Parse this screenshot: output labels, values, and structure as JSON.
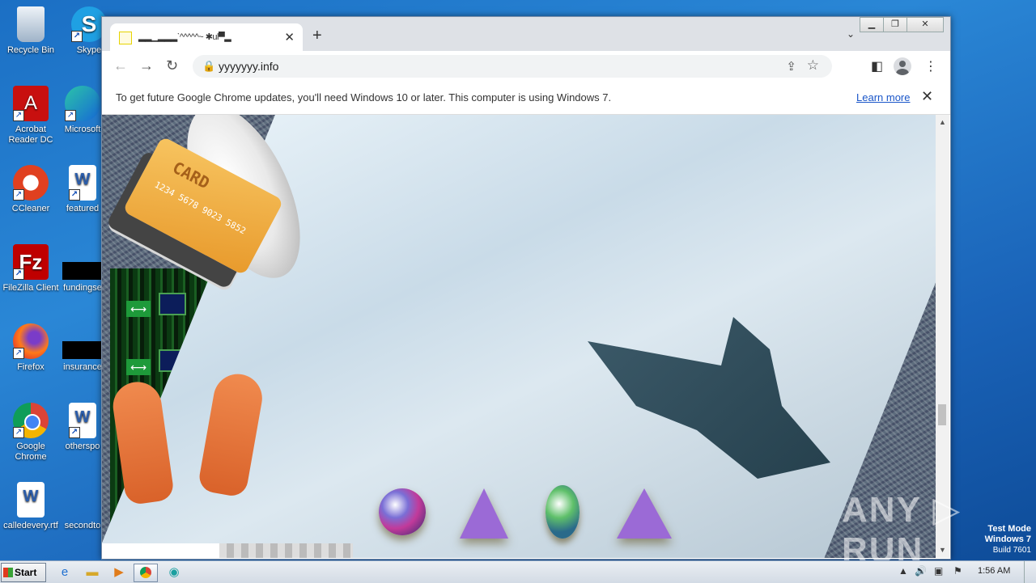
{
  "desktop": {
    "icons": [
      {
        "label": "Recycle Bin",
        "icon": "recycle-bin-icon"
      },
      {
        "label": "Skype",
        "icon": "skype-icon"
      },
      {
        "label": "Acrobat Reader DC",
        "icon": "acrobat-icon"
      },
      {
        "label": "Microsoft",
        "icon": "edge-icon"
      },
      {
        "label": "CCleaner",
        "icon": "ccleaner-icon"
      },
      {
        "label": "featured",
        "icon": "word-doc-icon"
      },
      {
        "label": "FileZilla Client",
        "icon": "filezilla-icon"
      },
      {
        "label": "fundingse",
        "icon": "file-icon"
      },
      {
        "label": "Firefox",
        "icon": "firefox-icon"
      },
      {
        "label": "insurance",
        "icon": "file-icon"
      },
      {
        "label": "Google Chrome",
        "icon": "chrome-icon"
      },
      {
        "label": "otherspo",
        "icon": "word-doc-icon"
      },
      {
        "label": "calledevery.rtf",
        "icon": "word-doc-icon"
      },
      {
        "label": "secondto",
        "icon": "file-icon"
      }
    ]
  },
  "browser": {
    "tab_title": "▂▂▁▂▂▂ˋ^^^^^~ ✱ul▀▂",
    "address": "yyyyyyy.info",
    "infobar": {
      "message": "To get future Google Chrome updates, you'll need Windows 10 or later. This computer is using Windows 7.",
      "link": "Learn more"
    },
    "page": {
      "card_text": "CARD",
      "card_number": "1234 5678 9023 5852"
    }
  },
  "watermark": "ANY ▷ RUN",
  "system": {
    "start_label": "Start",
    "clock": "1:56 AM",
    "test_mode": [
      "Test Mode",
      "Windows 7",
      "Build 7601"
    ]
  },
  "colors": {
    "desktop_blue": "#1b6fc4",
    "link_blue": "#1a56c9",
    "accent_pink": "#e02ce0"
  }
}
